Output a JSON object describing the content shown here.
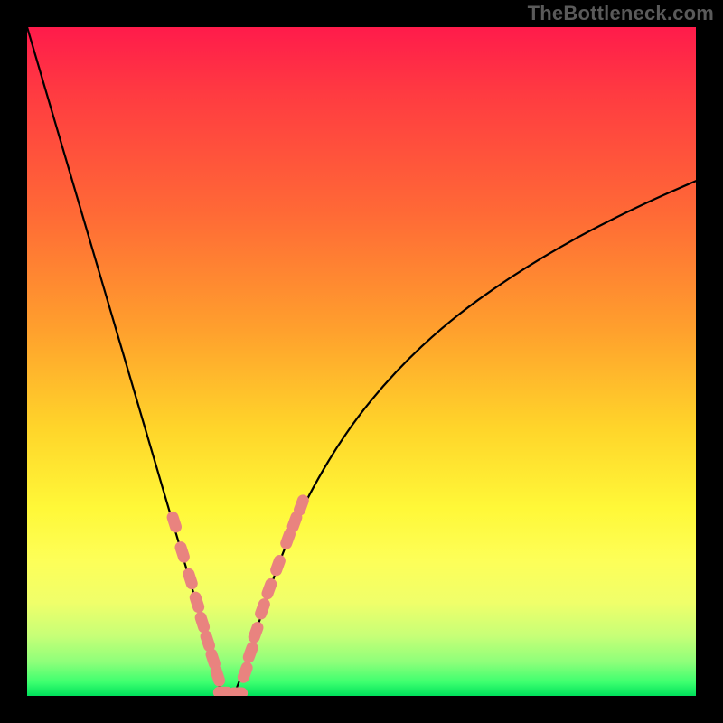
{
  "watermark": "TheBottleneck.com",
  "colors": {
    "background_frame": "#000000",
    "gradient_top": "#ff1b4b",
    "gradient_mid": "#ffd52a",
    "gradient_bottom": "#00e05b",
    "curve_color": "#000000",
    "marker_color": "#e9837f"
  },
  "chart_data": {
    "type": "line",
    "title": "",
    "xlabel": "",
    "ylabel": "",
    "xlim": [
      0,
      1
    ],
    "ylim": [
      0,
      1
    ],
    "x": [
      0.0,
      0.05,
      0.1,
      0.15,
      0.2,
      0.225,
      0.25,
      0.275,
      0.29,
      0.3,
      0.31,
      0.33,
      0.355,
      0.38,
      0.42,
      0.48,
      0.55,
      0.63,
      0.72,
      0.82,
      0.92,
      1.0
    ],
    "values": [
      1.0,
      0.83,
      0.66,
      0.49,
      0.32,
      0.235,
      0.15,
      0.065,
      0.0,
      0.0,
      0.0,
      0.06,
      0.135,
      0.21,
      0.3,
      0.4,
      0.485,
      0.56,
      0.625,
      0.685,
      0.735,
      0.77
    ],
    "annotations": [],
    "markers": {
      "note": "pill-shaped pink beads along curve near the bottom V",
      "left_branch": [
        {
          "x": 0.22,
          "y": 0.26
        },
        {
          "x": 0.232,
          "y": 0.215
        },
        {
          "x": 0.244,
          "y": 0.175
        },
        {
          "x": 0.254,
          "y": 0.14
        },
        {
          "x": 0.262,
          "y": 0.11
        },
        {
          "x": 0.27,
          "y": 0.082
        },
        {
          "x": 0.278,
          "y": 0.055
        },
        {
          "x": 0.285,
          "y": 0.03
        }
      ],
      "bottom": [
        {
          "x": 0.293,
          "y": 0.005
        },
        {
          "x": 0.303,
          "y": 0.002
        },
        {
          "x": 0.315,
          "y": 0.004
        }
      ],
      "right_branch": [
        {
          "x": 0.326,
          "y": 0.035
        },
        {
          "x": 0.334,
          "y": 0.065
        },
        {
          "x": 0.342,
          "y": 0.095
        },
        {
          "x": 0.352,
          "y": 0.13
        },
        {
          "x": 0.362,
          "y": 0.16
        },
        {
          "x": 0.375,
          "y": 0.195
        },
        {
          "x": 0.39,
          "y": 0.235
        },
        {
          "x": 0.4,
          "y": 0.26
        },
        {
          "x": 0.41,
          "y": 0.285
        }
      ]
    }
  }
}
